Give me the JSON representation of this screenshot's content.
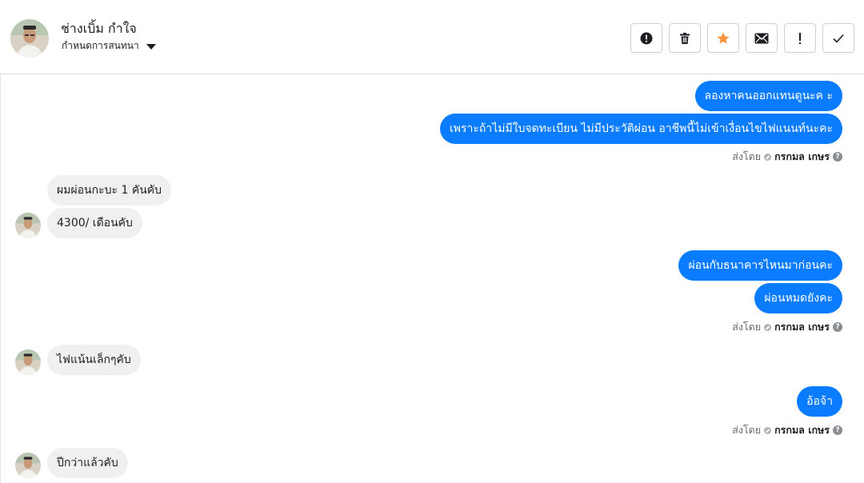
{
  "header": {
    "contact_name": "ช่างเบิ้ม กำใจ",
    "assign_label": "กำหนดการสนทนา",
    "actions": [
      {
        "icon": "alert-icon",
        "name": "mark-spam-button"
      },
      {
        "icon": "trash-icon",
        "name": "delete-button"
      },
      {
        "icon": "star-icon",
        "name": "star-button"
      },
      {
        "icon": "envelope-icon",
        "name": "mark-unread-button"
      },
      {
        "icon": "exclamation-icon",
        "name": "follow-up-button"
      },
      {
        "icon": "check-icon",
        "name": "mark-done-button"
      }
    ],
    "star_color": "#f7923b"
  },
  "thread": {
    "out_1": "ลองหาคนออกแทนดูนะค ะ",
    "out_2": "เพราะถ้าไม่มีใบจดทะเบียน ไม่มีประวัติผ่อน  อาชีพนี้ไม่เข้าเงื่อนไขไฟแนนท์นะคะ",
    "sent_1": {
      "prefix": "ส่งโดย",
      "who": "กรกมล เกษร"
    },
    "in_1": "ผมผ่อนกะบะ 1 คันคับ",
    "in_2": "4300/ เดือนคับ",
    "out_3": "ผ่อนกับธนาคารไหนมาก่อนคะ",
    "out_4": "ผ่อนหมดยังคะ",
    "sent_2": {
      "prefix": "ส่งโดย",
      "who": "กรกมล เกษร"
    },
    "in_3": "ไฟแน้นเล็กๆคับ",
    "out_5": "อ้อจ้า",
    "sent_3": {
      "prefix": "ส่งโดย",
      "who": "กรกมล เกษร"
    },
    "in_4": "ปีกว่าแล้วคับ"
  },
  "colors": {
    "outgoing": "#0a7cff",
    "incoming": "#f0f0f0"
  }
}
